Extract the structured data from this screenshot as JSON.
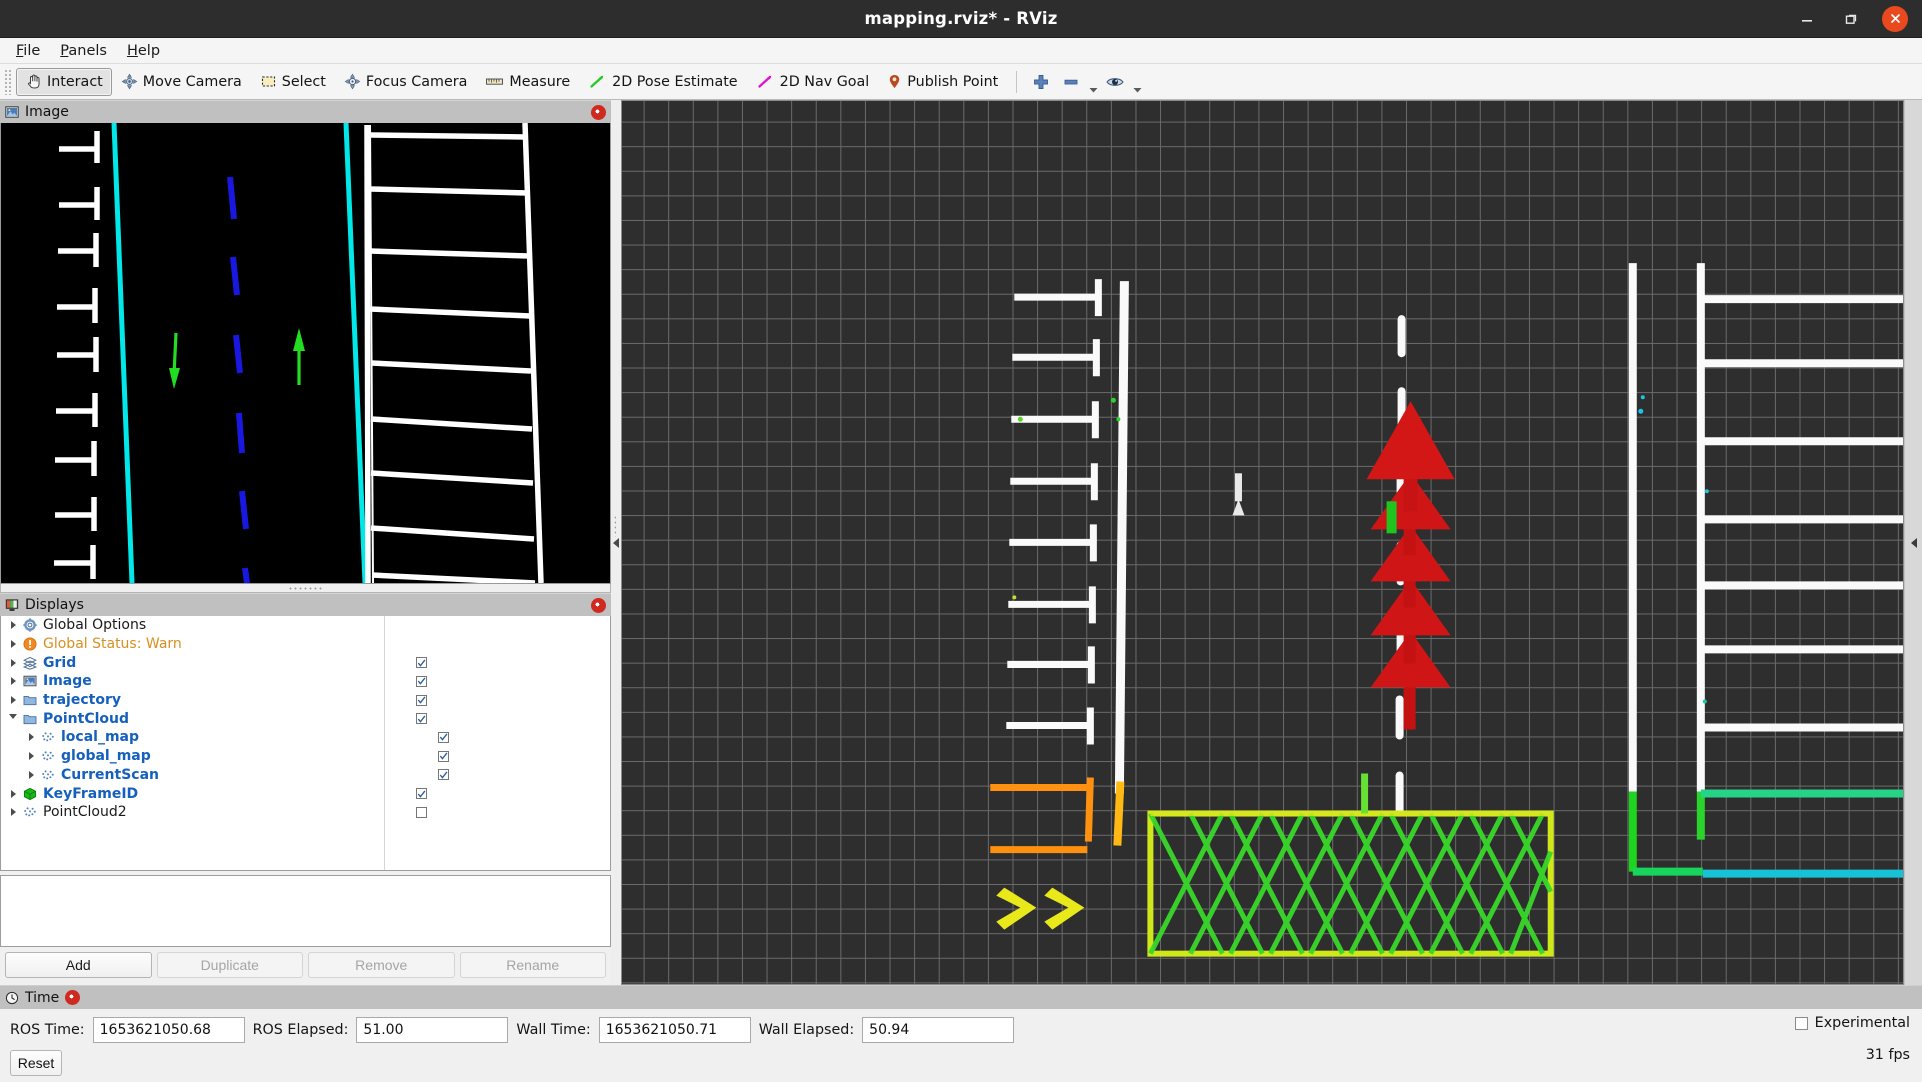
{
  "window": {
    "title": "mapping.rviz* - RViz",
    "minimize_icon": "minimize-icon",
    "maximize_icon": "maximize-icon",
    "close_icon": "close-icon"
  },
  "menubar": {
    "items": [
      {
        "label": "File",
        "mnemonic": "F"
      },
      {
        "label": "Panels",
        "mnemonic": "P"
      },
      {
        "label": "Help",
        "mnemonic": "H"
      }
    ]
  },
  "toolbar": {
    "tools": [
      {
        "label": "Interact",
        "icon": "hand-cursor-icon",
        "active": true
      },
      {
        "label": "Move Camera",
        "icon": "move-camera-icon",
        "active": false
      },
      {
        "label": "Select",
        "icon": "select-rectangle-icon",
        "active": false
      },
      {
        "label": "Focus Camera",
        "icon": "focus-camera-icon",
        "active": false
      },
      {
        "label": "Measure",
        "icon": "ruler-icon",
        "active": false
      },
      {
        "label": "2D Pose Estimate",
        "icon": "green-arrow-icon",
        "active": false
      },
      {
        "label": "2D Nav Goal",
        "icon": "magenta-arrow-icon",
        "active": false
      },
      {
        "label": "Publish Point",
        "icon": "map-pin-icon",
        "active": false
      }
    ],
    "zoom_in_icon": "plus-icon",
    "zoom_out_icon": "minus-icon",
    "view_icon": "eye-icon"
  },
  "image_panel": {
    "title": "Image",
    "icon": "image-panel-icon",
    "close_icon": "panel-close-icon"
  },
  "displays_panel": {
    "title": "Displays",
    "icon": "displays-panel-icon",
    "close_icon": "panel-close-icon",
    "tree": [
      {
        "label": "Global Options",
        "icon": "gear-icon",
        "style": "plain",
        "indent": 0,
        "expander": "closed",
        "checkbox": null
      },
      {
        "label": "Global Status: Warn",
        "icon": "warning-icon",
        "style": "warn",
        "indent": 0,
        "expander": "closed",
        "checkbox": null
      },
      {
        "label": "Grid",
        "icon": "grid-icon",
        "style": "link",
        "indent": 0,
        "expander": "closed",
        "checkbox": true
      },
      {
        "label": "Image",
        "icon": "image-icon",
        "style": "link",
        "indent": 0,
        "expander": "closed",
        "checkbox": true
      },
      {
        "label": "trajectory",
        "icon": "folder-icon",
        "style": "link",
        "indent": 0,
        "expander": "closed",
        "checkbox": true
      },
      {
        "label": "PointCloud",
        "icon": "folder-icon",
        "style": "link",
        "indent": 0,
        "expander": "open",
        "checkbox": true
      },
      {
        "label": "local_map",
        "icon": "pointcloud-icon",
        "style": "link",
        "indent": 1,
        "expander": "closed",
        "checkbox": true
      },
      {
        "label": "global_map",
        "icon": "pointcloud-icon",
        "style": "link",
        "indent": 1,
        "expander": "closed",
        "checkbox": true
      },
      {
        "label": "CurrentScan",
        "icon": "pointcloud-icon",
        "style": "link",
        "indent": 1,
        "expander": "closed",
        "checkbox": true
      },
      {
        "label": "KeyFrameID",
        "icon": "green-cube-icon",
        "style": "link",
        "indent": 0,
        "expander": "closed",
        "checkbox": true
      },
      {
        "label": "PointCloud2",
        "icon": "pointcloud-icon",
        "style": "plain",
        "indent": 0,
        "expander": "closed",
        "checkbox": false
      }
    ],
    "buttons": [
      {
        "label": "Add",
        "enabled": true
      },
      {
        "label": "Duplicate",
        "enabled": false
      },
      {
        "label": "Remove",
        "enabled": false
      },
      {
        "label": "Rename",
        "enabled": false
      }
    ]
  },
  "time_panel": {
    "title": "Time",
    "icon": "clock-icon",
    "close_icon": "panel-close-icon",
    "fields": [
      {
        "label": "ROS Time:",
        "value": "1653621050.68"
      },
      {
        "label": "ROS Elapsed:",
        "value": "51.00"
      },
      {
        "label": "Wall Time:",
        "value": "1653621050.71"
      },
      {
        "label": "Wall Elapsed:",
        "value": "50.94"
      }
    ],
    "reset_label": "Reset",
    "experimental_label": "Experimental",
    "experimental_checked": false,
    "fps": "31 fps"
  },
  "colors": {
    "viewport_bg": "#2e2e2e",
    "grid_line": "#6b6b6b",
    "pointcloud_white": "#ffffff",
    "pointcloud_green": "#2ae02a",
    "pointcloud_yellow": "#e8e82a",
    "pointcloud_orange": "#ff8c1a",
    "pointcloud_cyan": "#18c8e8",
    "arrow_red": "#d31616",
    "image_lane_cyan": "#00e5e5",
    "image_center_blue": "#1414e0",
    "image_arrow_green": "#22dd22",
    "link_blue": "#1560bd",
    "warn_orange": "#d79020",
    "titlebar_bg": "#2d2d2d",
    "close_red": "#e8491f"
  }
}
